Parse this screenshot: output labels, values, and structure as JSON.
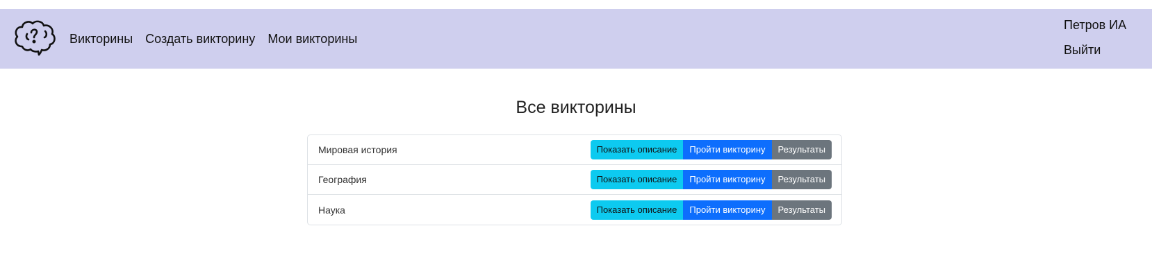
{
  "navbar": {
    "logo_icon": "brain-question-icon",
    "links": [
      {
        "label": "Викторины"
      },
      {
        "label": "Создать викторину"
      },
      {
        "label": "Мои викторины"
      }
    ],
    "user_name": "Петров ИА",
    "logout_label": "Выйти",
    "background": "#cfcfee"
  },
  "main": {
    "title": "Все викторины",
    "quizzes": [
      {
        "name": "Мировая история",
        "describe_label": "Показать описание",
        "take_label": "Пройти викторину",
        "results_label": "Результаты"
      },
      {
        "name": "География",
        "describe_label": "Показать описание",
        "take_label": "Пройти викторину",
        "results_label": "Результаты"
      },
      {
        "name": "Наука",
        "describe_label": "Показать описание",
        "take_label": "Пройти викторину",
        "results_label": "Результаты"
      }
    ]
  },
  "colors": {
    "info": "#0dcaf0",
    "primary": "#0d6efd",
    "secondary": "#6c757d"
  }
}
